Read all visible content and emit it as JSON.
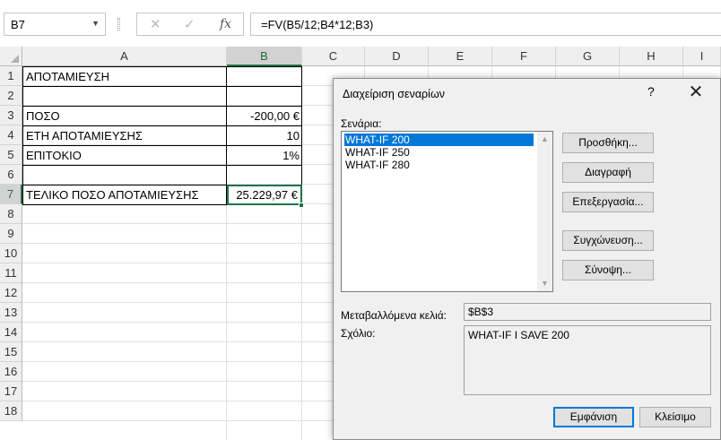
{
  "formula_bar": {
    "name_box": "B7",
    "formula": "=FV(B5/12;B4*12;B3)",
    "cancel_glyph": "✕",
    "enter_glyph": "✓",
    "fx_label": "fx"
  },
  "sheet": {
    "columns": [
      "A",
      "B",
      "C",
      "D",
      "E",
      "F",
      "G",
      "H",
      "I"
    ],
    "rows": [
      "1",
      "2",
      "3",
      "4",
      "5",
      "6",
      "7",
      "8",
      "9",
      "10",
      "11",
      "12",
      "13",
      "14",
      "15",
      "16",
      "17",
      "18"
    ],
    "cells": {
      "A1": "ΑΠΟΤΑΜΙΕΥΣΗ",
      "A3": "ΠΟΣΟ",
      "B3": "-200,00 €",
      "A4": "ΕΤΗ ΑΠΟΤΑΜΙΕΥΣΗΣ",
      "B4": "10",
      "A5": "ΕΠΙΤΟΚΙΟ",
      "B5": "1%",
      "A7": "ΤΕΛΙΚΟ ΠΟΣΟ ΑΠΟΤΑΜΙΕΥΣΗΣ",
      "B7": "25.229,97 €"
    },
    "selected_cell": "B7"
  },
  "dialog": {
    "title": "Διαχείριση σεναρίων",
    "help": "?",
    "close": "✕",
    "scenarios_label": "Σενάρια:",
    "scenarios": [
      "WHAT-IF 200",
      "WHAT-IF 250",
      "WHAT-IF 280"
    ],
    "selected_scenario": "WHAT-IF 200",
    "buttons": {
      "add": "Προσθήκη...",
      "delete": "Διαγραφή",
      "edit": "Επεξεργασία...",
      "merge": "Συγχώνευση...",
      "summary": "Σύνοψη...",
      "show": "Εμφάνιση",
      "close": "Κλείσιμο"
    },
    "changing_cells_label": "Μεταβαλλόμενα κελιά:",
    "changing_cells_value": "$B$3",
    "comment_label": "Σχόλιο:",
    "comment_value": "WHAT-IF I SAVE 200"
  },
  "colors": {
    "selection": "#217346",
    "list_highlight": "#0078d7"
  }
}
